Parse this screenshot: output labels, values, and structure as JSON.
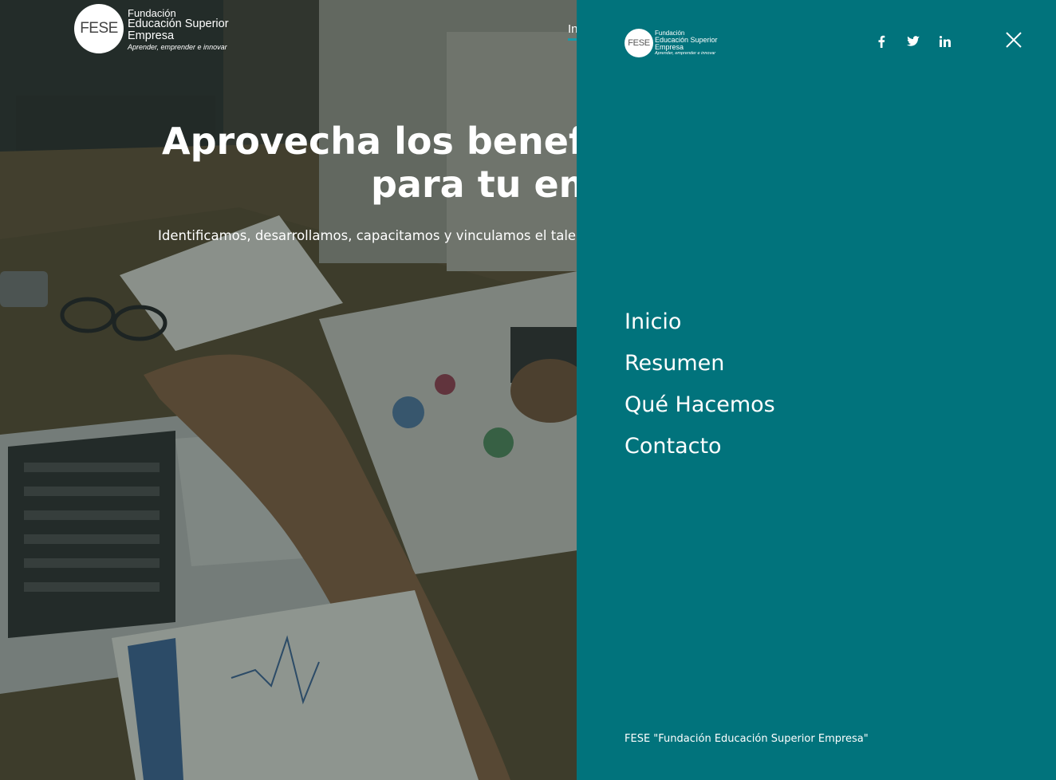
{
  "hero": {
    "logo": {
      "mark": "FESE",
      "line1": "Fundación",
      "line2": "Educación Superior",
      "line3": "Empresa",
      "tagline": "Aprender, emprender e innovar"
    },
    "nav_peek": "In",
    "title_line1": "Aprovecha los benefic",
    "title_line2": "para tu em",
    "subtitle": "Identificamos, desarrollamos, capacitamos y vinculamos el talento"
  },
  "drawer": {
    "background": "#01737c",
    "logo": {
      "mark": "FESE",
      "line1": "Fundación",
      "line2": "Educación Superior",
      "line3": "Empresa",
      "tagline": "Aprender, emprender e innovar"
    },
    "social": [
      {
        "icon": "facebook-icon"
      },
      {
        "icon": "twitter-icon"
      },
      {
        "icon": "linkedin-icon"
      }
    ],
    "close_icon": "close-icon",
    "menu": [
      "Inicio",
      "Resumen",
      "Qué Hacemos",
      "Contacto"
    ],
    "footer": "FESE \"Fundación Educación Superior Empresa\""
  }
}
